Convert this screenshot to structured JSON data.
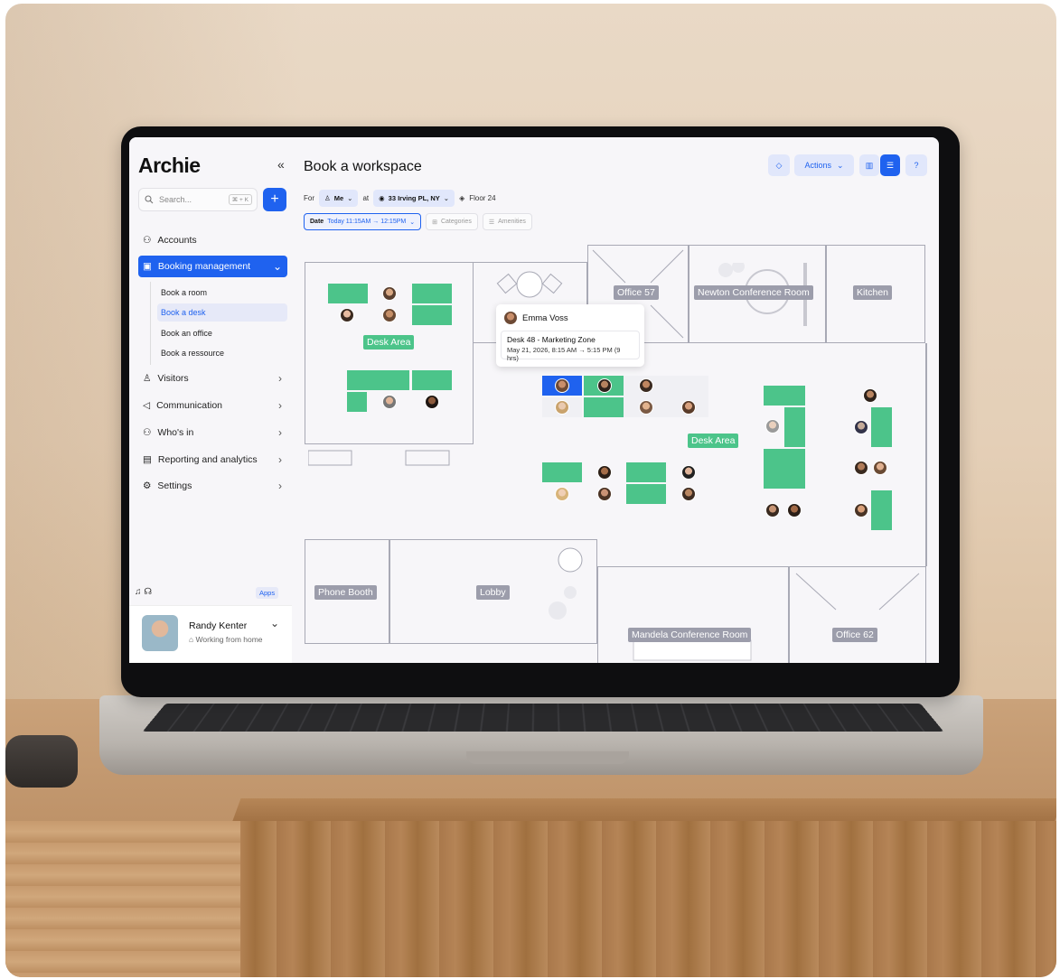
{
  "app": {
    "name": "Archie",
    "collapse_icon": "«"
  },
  "search": {
    "placeholder": "Search...",
    "shortcut": "⌘ + K"
  },
  "sidebar": {
    "items": [
      {
        "label": "Accounts"
      },
      {
        "label": "Booking management",
        "active": true
      },
      {
        "label": "Visitors"
      },
      {
        "label": "Communication"
      },
      {
        "label": "Who's in"
      },
      {
        "label": "Reporting and analytics"
      },
      {
        "label": "Settings"
      }
    ],
    "sub_items": [
      {
        "label": "Book a room"
      },
      {
        "label": "Book a desk",
        "selected": true
      },
      {
        "label": "Book an office"
      },
      {
        "label": "Book a ressource"
      }
    ],
    "apps_label": "Apps"
  },
  "user": {
    "name": "Randy Kenter",
    "status": "Working from home"
  },
  "header": {
    "title": "Book a workspace",
    "actions_label": "Actions"
  },
  "filters": {
    "for_label": "For",
    "person": "Me",
    "at_label": "at",
    "location": "33 Irving PL, NY",
    "floor": "Floor 24",
    "date_label": "Date",
    "date_value": "Today 11:15AM → 12:15PM",
    "categories": "Categories",
    "amenities": "Amenities"
  },
  "plan": {
    "areas": [
      "Desk Area",
      "Desk Area",
      "Office 57",
      "Newton Conference Room",
      "Kitchen",
      "Phone Booth",
      "Lobby",
      "Mandela Conference Room",
      "Office 62"
    ],
    "tooltip": {
      "name": "Emma Voss",
      "desk": "Desk 48 - Marketing Zone",
      "time": "May 21, 2026, 8:15 AM → 5:15 PM (9 hrs)"
    }
  },
  "colors": {
    "accent": "#1f62ef",
    "desk_available": "#4cc48a",
    "room_label": "#9c9dab"
  }
}
